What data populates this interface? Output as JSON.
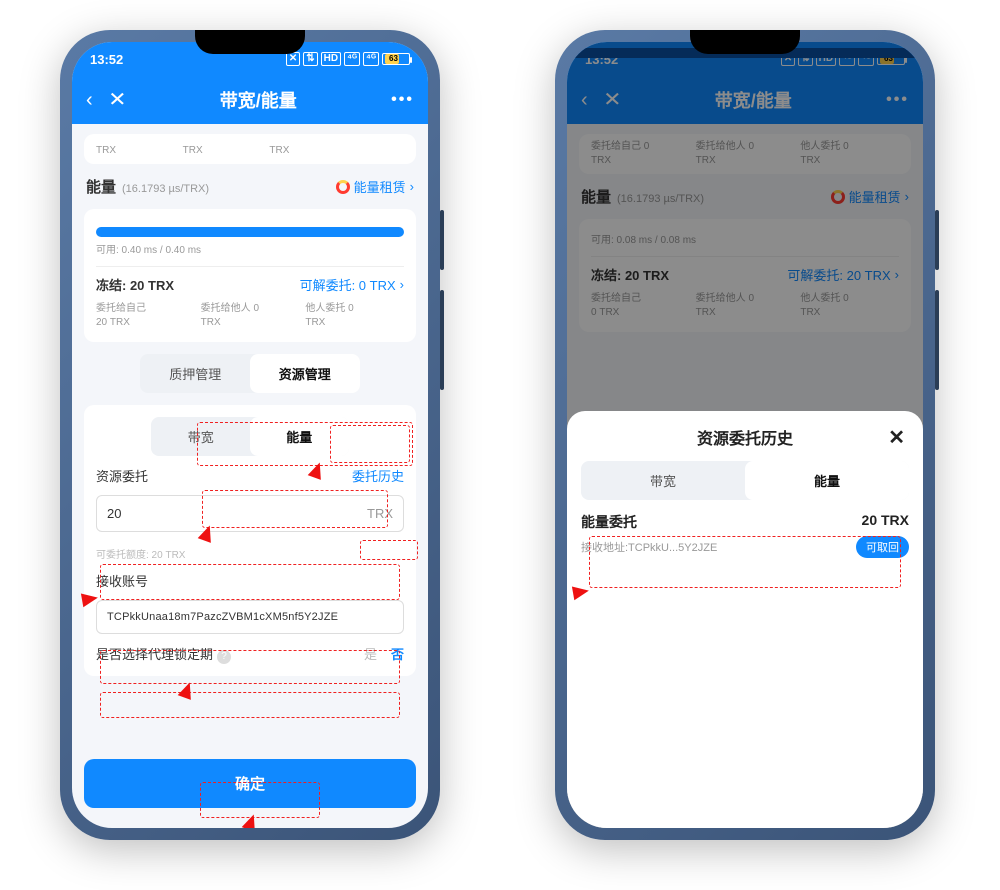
{
  "status": {
    "time": "13:52",
    "hd": "HD",
    "batt": "63"
  },
  "nav": {
    "title": "带宽/能量"
  },
  "energy": {
    "title": "能量",
    "rate": "(16.1793 µs/TRX)",
    "rentLink": "能量租赁",
    "usable_left": "可用: 0.40 ms / 0.40 ms",
    "usable_right": "可用: 0.08 ms / 0.08 ms",
    "frozen": "冻结: 20 TRX",
    "canUndelegate_left": "可解委托: 0 TRX",
    "canUndelegate_right": "可解委托: 20 TRX",
    "cols": {
      "self": "委托给自己",
      "selfVal_l": "20 TRX",
      "selfVal_r": "0 TRX",
      "others": "委托给他人 0",
      "othersVal": "TRX",
      "fromOthers": "他人委托 0",
      "fromOthersVal": "TRX"
    }
  },
  "tabs_outer": {
    "stake": "质押管理",
    "resource": "资源管理"
  },
  "tabs_inner": {
    "bw": "带宽",
    "en": "能量"
  },
  "form": {
    "delegateLabel": "资源委托",
    "historyLink": "委托历史",
    "amount": "20",
    "unit": "TRX",
    "quota": "可委托额度: 20 TRX",
    "recvLabel": "接收账号",
    "address": "TCPkkUnaa18m7PazcZVBM1cXM5nf5Y2JZE",
    "lockLabel": "是否选择代理锁定期",
    "yes": "是",
    "no": "否",
    "confirm": "确定"
  },
  "sheet": {
    "title": "资源委托历史",
    "delegateTitle": "能量委托",
    "amount": "20 TRX",
    "recvLabel": "接收地址:TCPkkU...5Y2JZE",
    "cancel": "可取回"
  }
}
